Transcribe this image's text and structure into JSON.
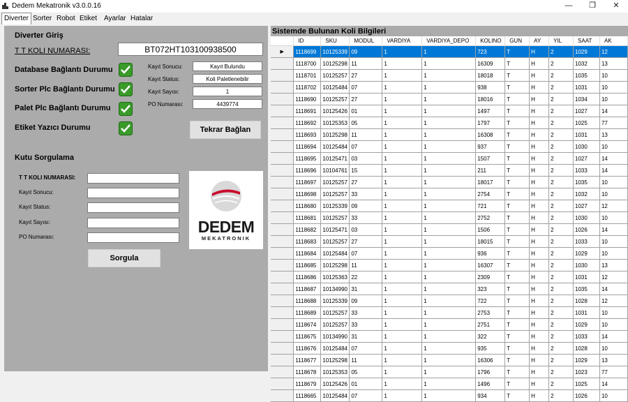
{
  "window": {
    "title": "Dedem Mekatronik v3.0.0.16",
    "minimize": "—",
    "restore": "❐",
    "close": "✕"
  },
  "tabs": [
    "Diverter",
    "Sorter",
    "Robot",
    "Etiket",
    "Ayarlar",
    "Hatalar"
  ],
  "left": {
    "diverter_title": "Diverter Giriş",
    "koli_label": "T T KOLI NUMARASI:",
    "koli_value": "BT072HT103100938500",
    "status_items": [
      "Database Bağlantı Durumu",
      "Sorter Plc Bağlantı Durumu",
      "Palet Plc Bağlantı Durumu",
      "Etiket Yazıcı Durumu"
    ],
    "info_labels": [
      "Kayıt Sonucu:",
      "Kayıt Status:",
      "Kayıt Sayısı:",
      "PO Numarası:"
    ],
    "info_values": [
      "Kayıt Bulundu",
      "Koli Paletlenebilir",
      "1",
      "4439774"
    ],
    "reconnect_button": "Tekrar Bağlan",
    "kutu_title": "Kutu Sorgulama",
    "query_labels": [
      "T T KOLI NUMARASI:",
      "Kayıt Sonucu:",
      "Kayıt Status:",
      "Kayıt Sayısı:",
      "PO Numarası:"
    ],
    "query_button": "Sorgula",
    "logo_main": "DEDEM",
    "logo_sub": "MEKATRONIK"
  },
  "grid": {
    "title": "Sistemde Bulunan Koli Bilgileri",
    "columns": [
      "ID",
      "SKU",
      "MODUL",
      "VARDIYA",
      "VARDIYA_DEPO",
      "KOLINO",
      "GUN",
      "AY",
      "YIL",
      "SAAT",
      "AK"
    ],
    "rows": [
      [
        "1118699",
        "10125339",
        "09",
        "1",
        "1",
        "723",
        "T",
        "H",
        "2",
        "1029",
        "12"
      ],
      [
        "1118700",
        "10125298",
        "11",
        "1",
        "1",
        "16309",
        "T",
        "H",
        "2",
        "1032",
        "13"
      ],
      [
        "1118701",
        "10125257",
        "27",
        "1",
        "1",
        "18018",
        "T",
        "H",
        "2",
        "1035",
        "10"
      ],
      [
        "1118702",
        "10125484",
        "07",
        "1",
        "1",
        "938",
        "T",
        "H",
        "2",
        "1031",
        "10"
      ],
      [
        "1118690",
        "10125257",
        "27",
        "1",
        "1",
        "18016",
        "T",
        "H",
        "2",
        "1034",
        "10"
      ],
      [
        "1118691",
        "10125426",
        "01",
        "1",
        "1",
        "1497",
        "T",
        "H",
        "2",
        "1027",
        "14"
      ],
      [
        "1118692",
        "10125353",
        "05",
        "1",
        "1",
        "1797",
        "T",
        "H",
        "2",
        "1025",
        "77"
      ],
      [
        "1118693",
        "10125298",
        "11",
        "1",
        "1",
        "16308",
        "T",
        "H",
        "2",
        "1031",
        "13"
      ],
      [
        "1118694",
        "10125484",
        "07",
        "1",
        "1",
        "937",
        "T",
        "H",
        "2",
        "1030",
        "10"
      ],
      [
        "1118695",
        "10125471",
        "03",
        "1",
        "1",
        "1507",
        "T",
        "H",
        "2",
        "1027",
        "14"
      ],
      [
        "1118696",
        "10104761",
        "15",
        "1",
        "1",
        "211",
        "T",
        "H",
        "2",
        "1033",
        "14"
      ],
      [
        "1118697",
        "10125257",
        "27",
        "1",
        "1",
        "18017",
        "T",
        "H",
        "2",
        "1035",
        "10"
      ],
      [
        "1118698",
        "10125257",
        "33",
        "1",
        "1",
        "2754",
        "T",
        "H",
        "2",
        "1032",
        "10"
      ],
      [
        "1118680",
        "10125339",
        "09",
        "1",
        "1",
        "721",
        "T",
        "H",
        "2",
        "1027",
        "12"
      ],
      [
        "1118681",
        "10125257",
        "33",
        "1",
        "1",
        "2752",
        "T",
        "H",
        "2",
        "1030",
        "10"
      ],
      [
        "1118682",
        "10125471",
        "03",
        "1",
        "1",
        "1506",
        "T",
        "H",
        "2",
        "1026",
        "14"
      ],
      [
        "1118683",
        "10125257",
        "27",
        "1",
        "1",
        "18015",
        "T",
        "H",
        "2",
        "1033",
        "10"
      ],
      [
        "1118684",
        "10125484",
        "07",
        "1",
        "1",
        "936",
        "T",
        "H",
        "2",
        "1029",
        "10"
      ],
      [
        "1118685",
        "10125298",
        "11",
        "1",
        "1",
        "16307",
        "T",
        "H",
        "2",
        "1030",
        "13"
      ],
      [
        "1118686",
        "10125363",
        "22",
        "1",
        "1",
        "2309",
        "T",
        "H",
        "2",
        "1031",
        "12"
      ],
      [
        "1118687",
        "10134990",
        "31",
        "1",
        "1",
        "323",
        "T",
        "H",
        "2",
        "1035",
        "14"
      ],
      [
        "1118688",
        "10125339",
        "09",
        "1",
        "1",
        "722",
        "T",
        "H",
        "2",
        "1028",
        "12"
      ],
      [
        "1118689",
        "10125257",
        "33",
        "1",
        "1",
        "2753",
        "T",
        "H",
        "2",
        "1031",
        "10"
      ],
      [
        "1118674",
        "10125257",
        "33",
        "1",
        "1",
        "2751",
        "T",
        "H",
        "2",
        "1029",
        "10"
      ],
      [
        "1118675",
        "10134990",
        "31",
        "1",
        "1",
        "322",
        "T",
        "H",
        "2",
        "1033",
        "14"
      ],
      [
        "1118676",
        "10125484",
        "07",
        "1",
        "1",
        "935",
        "T",
        "H",
        "2",
        "1028",
        "10"
      ],
      [
        "1118677",
        "10125298",
        "11",
        "1",
        "1",
        "16306",
        "T",
        "H",
        "2",
        "1029",
        "13"
      ],
      [
        "1118678",
        "10125353",
        "05",
        "1",
        "1",
        "1796",
        "T",
        "H",
        "2",
        "1023",
        "77"
      ],
      [
        "1118679",
        "10125426",
        "01",
        "1",
        "1",
        "1496",
        "T",
        "H",
        "2",
        "1025",
        "14"
      ],
      [
        "1118665",
        "10125484",
        "07",
        "1",
        "1",
        "934",
        "T",
        "H",
        "2",
        "1026",
        "10"
      ]
    ],
    "selected_row": 0,
    "row_indicator": "▶"
  },
  "colors": {
    "selection": "#0078d7",
    "panel": "#ababab",
    "ok_green": "#3a9a2a"
  }
}
